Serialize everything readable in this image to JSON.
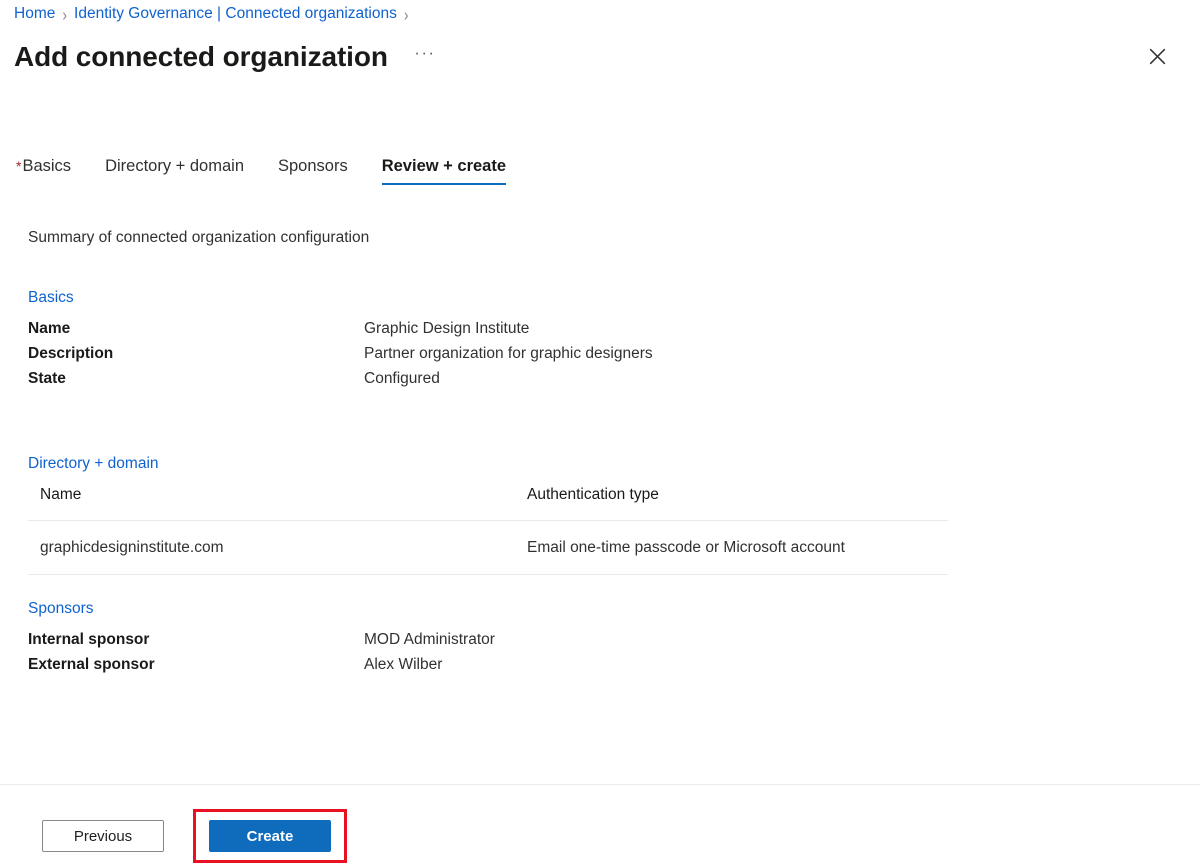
{
  "breadcrumb": {
    "items": [
      {
        "label": "Home",
        "link": true
      },
      {
        "label": "Identity Governance | Connected organizations",
        "link": true
      }
    ],
    "separator": "›",
    "trailing_separator": "›"
  },
  "header": {
    "title": "Add connected organization",
    "more_label": "···",
    "close_icon": "close-icon"
  },
  "tabs": [
    {
      "label": "Basics",
      "required": true,
      "required_marker": "*",
      "selected": false
    },
    {
      "label": "Directory + domain",
      "required": false,
      "required_marker": "",
      "selected": false
    },
    {
      "label": "Sponsors",
      "required": false,
      "required_marker": "",
      "selected": false
    },
    {
      "label": "Review + create",
      "required": false,
      "required_marker": "",
      "selected": true
    }
  ],
  "main": {
    "summary_line": "Summary of connected organization configuration",
    "basics": {
      "section_title": "Basics",
      "rows": [
        {
          "key": "Name",
          "value": "Graphic Design Institute"
        },
        {
          "key": "Description",
          "value": "Partner organization for graphic designers"
        },
        {
          "key": "State",
          "value": "Configured"
        }
      ]
    },
    "directory": {
      "section_title": "Directory + domain",
      "columns": [
        "Name",
        "Authentication type"
      ],
      "rows": [
        {
          "name": "graphicdesigninstitute.com",
          "auth_type": "Email one-time passcode or Microsoft account"
        }
      ]
    },
    "sponsors": {
      "section_title": "Sponsors",
      "rows": [
        {
          "key": "Internal sponsor",
          "value": "MOD Administrator"
        },
        {
          "key": "External sponsor",
          "value": "Alex Wilber"
        }
      ]
    }
  },
  "footer": {
    "previous_label": "Previous",
    "create_label": "Create",
    "highlight_color": "#e81123"
  },
  "colors": {
    "link": "#0f62d0",
    "accent": "#0f6cbd",
    "primary_button": "#0f6cbd",
    "required_asterisk": "#a4262c",
    "highlight": "#e81123"
  }
}
